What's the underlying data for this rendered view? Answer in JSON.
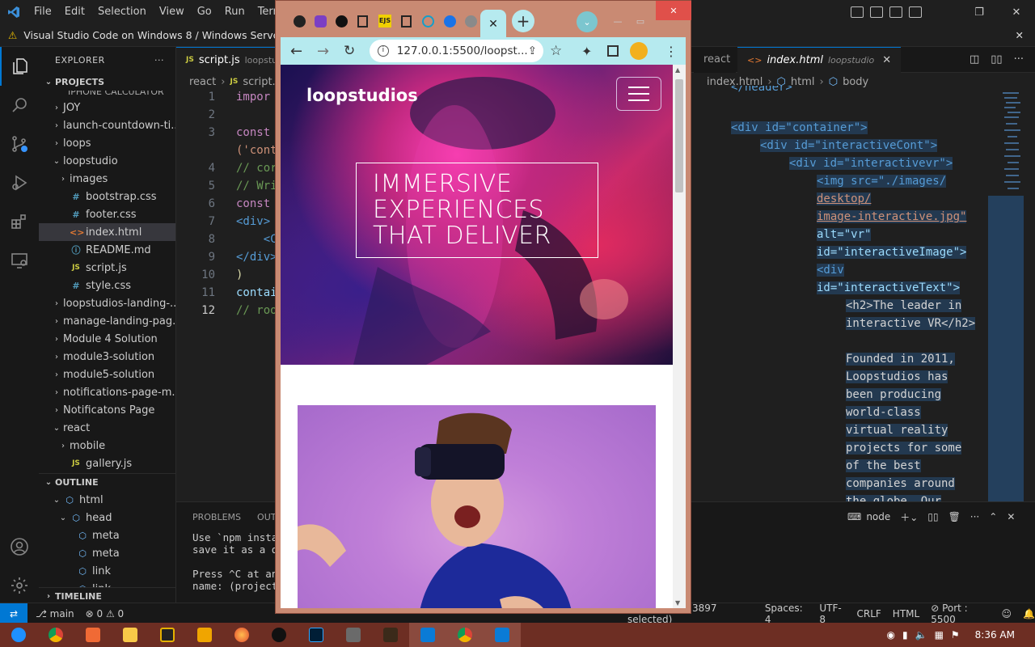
{
  "vscode": {
    "menu": [
      "File",
      "Edit",
      "Selection",
      "View",
      "Go",
      "Run",
      "Termina"
    ],
    "banner": "Visual Studio Code on Windows 8 / Windows Server 2012",
    "explorer": {
      "title": "EXPLORER",
      "section": "PROJECTS",
      "clipped_top": "IPHONE CALCULATOR",
      "items": [
        {
          "label": "JOY",
          "kind": "folder",
          "depth": 1,
          "open": false
        },
        {
          "label": "launch-countdown-ti...",
          "kind": "folder",
          "depth": 1,
          "open": false
        },
        {
          "label": "loops",
          "kind": "folder",
          "depth": 1,
          "open": false
        },
        {
          "label": "loopstudio",
          "kind": "folder",
          "depth": 1,
          "open": true
        },
        {
          "label": "images",
          "kind": "folder",
          "depth": 2,
          "open": false
        },
        {
          "label": "bootstrap.css",
          "kind": "css",
          "depth": 2
        },
        {
          "label": "footer.css",
          "kind": "css",
          "depth": 2
        },
        {
          "label": "index.html",
          "kind": "html",
          "depth": 2,
          "selected": true
        },
        {
          "label": "README.md",
          "kind": "md",
          "depth": 2
        },
        {
          "label": "script.js",
          "kind": "js",
          "depth": 2
        },
        {
          "label": "style.css",
          "kind": "css",
          "depth": 2
        },
        {
          "label": "loopstudios-landing-...",
          "kind": "folder",
          "depth": 1,
          "open": false
        },
        {
          "label": "manage-landing-pag...",
          "kind": "folder",
          "depth": 1,
          "open": false
        },
        {
          "label": "Module 4 Solution",
          "kind": "folder",
          "depth": 1,
          "open": false
        },
        {
          "label": "module3-solution",
          "kind": "folder",
          "depth": 1,
          "open": false
        },
        {
          "label": "module5-solution",
          "kind": "folder",
          "depth": 1,
          "open": false
        },
        {
          "label": "notifications-page-m...",
          "kind": "folder",
          "depth": 1,
          "open": false
        },
        {
          "label": "Notificatons Page",
          "kind": "folder",
          "depth": 1,
          "open": false
        },
        {
          "label": "react",
          "kind": "folder",
          "depth": 1,
          "open": true
        },
        {
          "label": "mobile",
          "kind": "folder",
          "depth": 2,
          "open": false
        },
        {
          "label": "gallery.js",
          "kind": "js",
          "depth": 2
        }
      ],
      "outline_title": "OUTLINE",
      "outline": [
        {
          "label": "html",
          "depth": 1
        },
        {
          "label": "head",
          "depth": 2
        },
        {
          "label": "meta",
          "depth": 3
        },
        {
          "label": "meta",
          "depth": 3
        },
        {
          "label": "link",
          "depth": 3
        },
        {
          "label": "link",
          "depth": 3
        }
      ],
      "timeline_title": "TIMELINE"
    },
    "editor_left": {
      "tab": "script.js",
      "tab_desc": "loopstu",
      "breadcrumb": [
        "react",
        "script.js"
      ],
      "lines": [
        {
          "n": "1",
          "text": "impor"
        },
        {
          "n": "2",
          "text": ""
        },
        {
          "n": "3",
          "text": "const"
        },
        {
          "n": "",
          "text": "('cont"
        },
        {
          "n": "4",
          "text": "// cor"
        },
        {
          "n": "5",
          "text": "// Wri"
        },
        {
          "n": "6",
          "text": "const"
        },
        {
          "n": "7",
          "text": "<div>"
        },
        {
          "n": "8",
          "text": "    <C"
        },
        {
          "n": "9",
          "text": "</div>"
        },
        {
          "n": "10",
          "text": ")"
        },
        {
          "n": "11",
          "text": "contai"
        },
        {
          "n": "12",
          "text": "// roo"
        }
      ]
    },
    "panel": {
      "tabs": [
        "PROBLEMS",
        "OUTI"
      ],
      "terminal_lines": [
        "Use `npm instal",
        "save it as a de",
        "",
        "Press ^C at any",
        "name: (projects"
      ]
    },
    "editor_right": {
      "tab_prev": "react",
      "tab": "index.html",
      "tab_desc": "loopstudio",
      "breadcrumb": [
        "index.html",
        "html",
        "body"
      ],
      "clipped_top": "</header>",
      "lines": [
        "<div id=\"container\">",
        "<div id=\"interactiveCont\">",
        "<div id=\"interactivevr\">",
        "<img src=\"./images/",
        "desktop/",
        "image-interactive.jpg\"",
        "alt=\"vr\"",
        "id=\"interactiveImage\">",
        "<div",
        "id=\"interactiveText\">",
        "<h2>The leader in",
        "interactive VR</h2>",
        "",
        "Founded in 2011,",
        "Loopstudios has",
        "been producing",
        "world-class",
        "virtual reality",
        "projects for some",
        "of the best",
        "companies around",
        "the globe. Our"
      ],
      "terminal": "node"
    },
    "statusbar": {
      "branch": "main",
      "errors": "0",
      "warnings": "0",
      "position": "Ln 50, Col 1 (3897 selected)",
      "spaces": "Spaces: 4",
      "encoding": "UTF-8",
      "eol": "CRLF",
      "language": "HTML",
      "port": "Port : 5500"
    }
  },
  "browser": {
    "url": "127.0.0.1:5500/loopst...",
    "page": {
      "brand": "loopstudios",
      "headline": [
        "IMMERSIVE",
        "EXPERIENCES",
        "THAT DELIVER"
      ]
    }
  },
  "taskbar": {
    "time": "8:36 AM"
  },
  "colors": {
    "accent": "#0078d4",
    "taskbar": "#6d2e23",
    "chrome_frame": "#c98a73",
    "chrome_toolbar": "#b6eaef"
  }
}
